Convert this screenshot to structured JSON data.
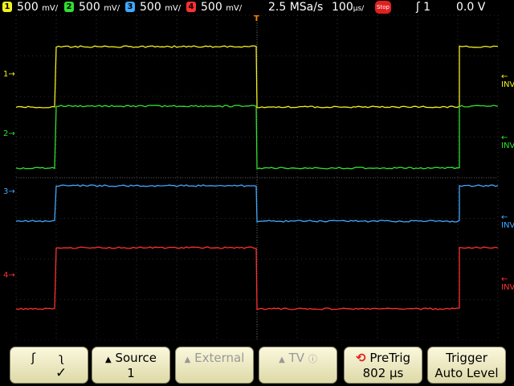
{
  "topbar": {
    "ch1": {
      "num": "1",
      "scale": "500",
      "unit": "mV/",
      "color": "#f0f020"
    },
    "ch2": {
      "num": "2",
      "scale": "500",
      "unit": "mV/",
      "color": "#30e030"
    },
    "ch3": {
      "num": "3",
      "scale": "500",
      "unit": "mV/",
      "color": "#40a8ff"
    },
    "ch4": {
      "num": "4",
      "scale": "500",
      "unit": "mV/",
      "color": "#ff3030"
    },
    "sample_rate": "2.5 MSa/s",
    "timebase": "100",
    "timebase_unit": "µs/",
    "stop_label": "Stop",
    "trigger_slope": "ʃ",
    "trigger_source": "1",
    "trigger_level": "0.0 V"
  },
  "channels": {
    "ch1": {
      "label": "1",
      "inv": "INV"
    },
    "ch2": {
      "label": "2",
      "inv": "INV"
    },
    "ch3": {
      "label": "3",
      "inv": "INV"
    },
    "ch4": {
      "label": "4",
      "inv": "INV"
    }
  },
  "trigger_marker": "T",
  "softkeys": {
    "slope": {
      "rise": "ʃ",
      "fall": "ʅ",
      "check": "✓"
    },
    "source": {
      "label": "Source",
      "value": "1"
    },
    "external": {
      "label": "External"
    },
    "tv": {
      "label": "TV",
      "info": "ⓘ"
    },
    "pretrig": {
      "label": "PreTrig",
      "value": "802 µs"
    },
    "trigger": {
      "label": "Trigger",
      "value": "Auto Level"
    }
  },
  "colors": {
    "ch1": "#f0f020",
    "ch2": "#30e030",
    "ch3": "#40a8ff",
    "ch4": "#ff3030",
    "grid": "#555555"
  }
}
